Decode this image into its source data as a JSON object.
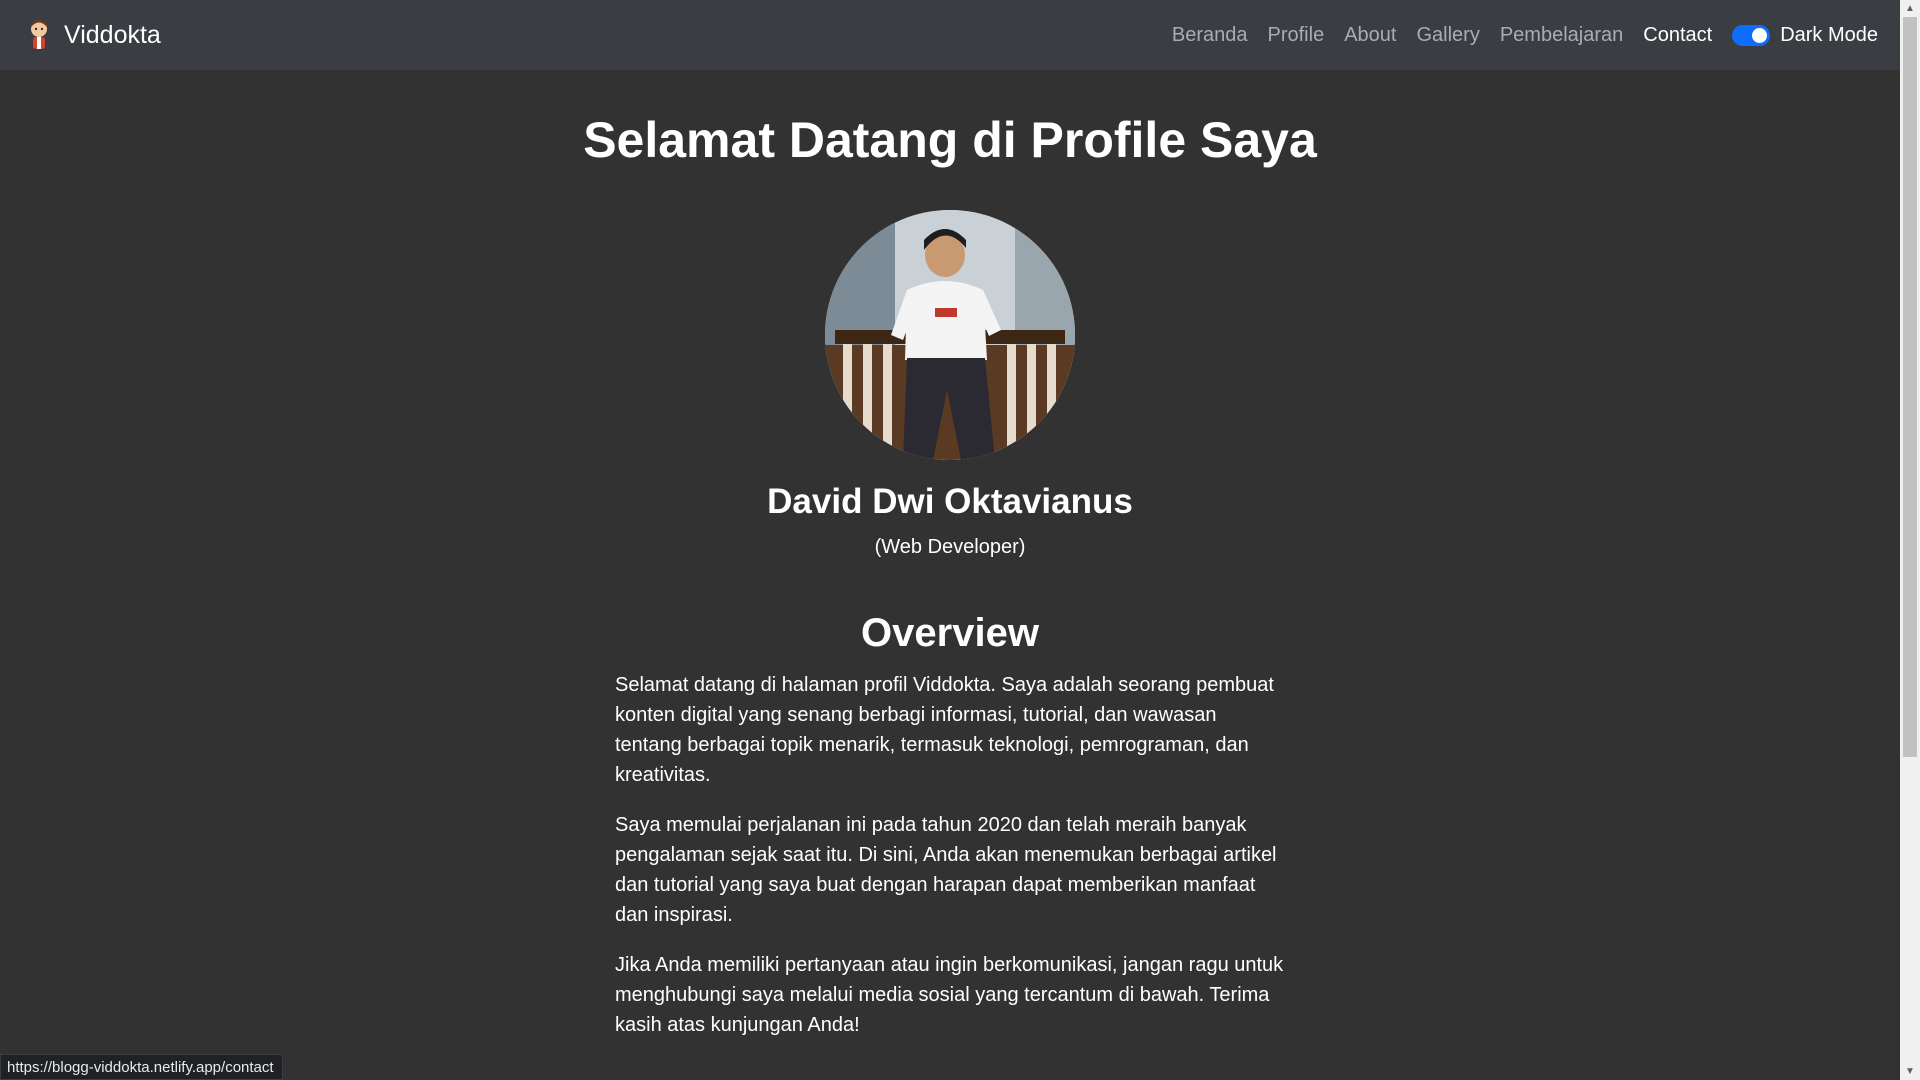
{
  "navbar": {
    "brand": "Viddokta",
    "links": [
      "Beranda",
      "Profile",
      "About",
      "Gallery",
      "Pembelajaran",
      "Contact"
    ],
    "active_link": "Contact",
    "toggle_label": "Dark Mode",
    "toggle_on": true,
    "accent_color": "#0d6efd"
  },
  "main": {
    "title": "Selamat Datang di Profile Saya",
    "name": "David Dwi Oktavianus",
    "role": "(Web Developer)",
    "overview_title": "Overview",
    "paragraphs": [
      "Selamat datang di halaman profil Viddokta. Saya adalah seorang pembuat konten digital yang senang berbagi informasi, tutorial, dan wawasan tentang berbagai topik menarik, termasuk teknologi, pemrograman, dan kreativitas.",
      "Saya memulai perjalanan ini pada tahun 2020 dan telah meraih banyak pengalaman sejak saat itu. Di sini, Anda akan menemukan berbagai artikel dan tutorial yang saya buat dengan harapan dapat memberikan manfaat dan inspirasi.",
      "Jika Anda memiliki pertanyaan atau ingin berkomunikasi, jangan ragu untuk menghubungi saya melalui media sosial yang tercantum di bawah. Terima kasih atas kunjungan Anda!"
    ]
  },
  "statusbar": {
    "url": "https://blogg-viddokta.netlify.app/contact"
  }
}
